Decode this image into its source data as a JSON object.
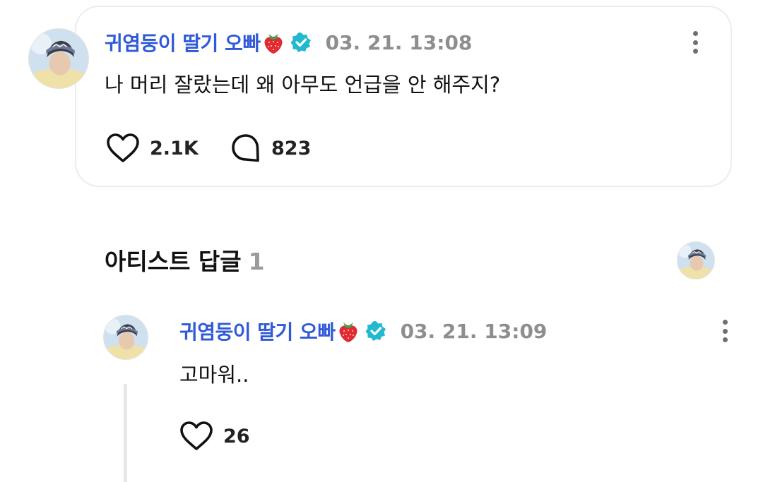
{
  "post": {
    "author": "귀염둥이 딸기 오빠",
    "timestamp": "03. 21. 13:08",
    "text": "나 머리 잘랐는데 왜 아무도 언급을 안 해주지?",
    "likes": "2.1K",
    "comments": "823"
  },
  "replies_section": {
    "title": "아티스트 답글",
    "count": "1"
  },
  "reply": {
    "author": "귀염둥이 딸기 오빠",
    "timestamp": "03. 21. 13:09",
    "text": "고마워..",
    "likes": "26"
  },
  "icons": {
    "verified": "verified-badge-icon",
    "strawberry": "strawberry-emoji",
    "like": "heart-outline-icon",
    "comment": "speech-bubble-icon",
    "more": "vertical-ellipsis-icon"
  },
  "colors": {
    "author_name": "#2f59d9",
    "verified_badge": "#22b8cf",
    "timestamp": "#8e8e8e"
  }
}
